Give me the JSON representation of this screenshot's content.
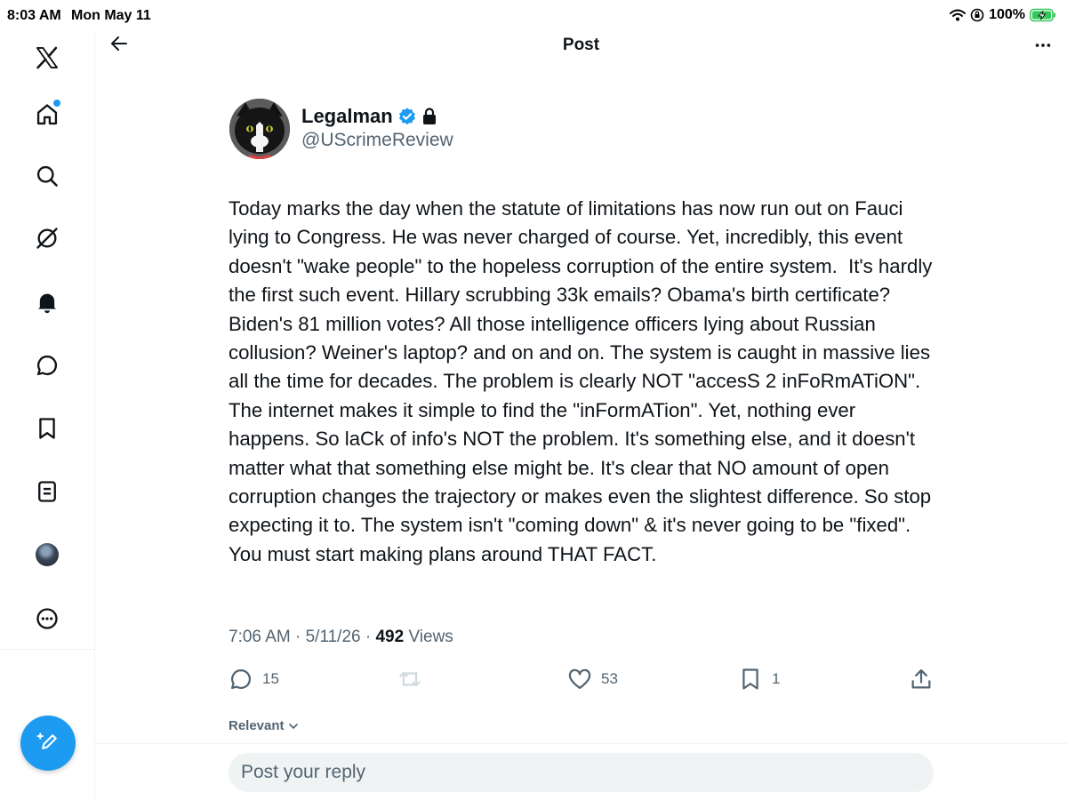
{
  "status_bar": {
    "time": "8:03 AM",
    "date": "Mon May 11",
    "battery": "100%",
    "icons": [
      "wifi-icon",
      "orientation-lock-icon",
      "battery-charging-icon"
    ]
  },
  "sidebar": {
    "items": [
      {
        "name": "x-logo",
        "icon": "x-logo-icon"
      },
      {
        "name": "home",
        "icon": "home-icon",
        "has_notification_dot": true
      },
      {
        "name": "explore",
        "icon": "search-icon"
      },
      {
        "name": "grok",
        "icon": "grok-icon"
      },
      {
        "name": "notifications",
        "icon": "bell-icon"
      },
      {
        "name": "messages",
        "icon": "message-icon"
      },
      {
        "name": "bookmarks",
        "icon": "bookmark-icon"
      },
      {
        "name": "lists",
        "icon": "list-icon"
      },
      {
        "name": "profile",
        "icon": "avatar"
      },
      {
        "name": "more",
        "icon": "more-circle-icon"
      }
    ],
    "compose_icon": "compose-icon"
  },
  "header": {
    "title": "Post",
    "back_icon": "arrow-left-icon",
    "more_icon": "more-dots-icon"
  },
  "post": {
    "author_name": "Legalman",
    "author_handle": "@UScrimeReview",
    "verified": true,
    "protected": true,
    "text": "Today marks the day when the statute of limitations has now run out on Fauci lying to Congress. He was never charged of course. Yet, incredibly, this event doesn't \"wake people\" to the hopeless corruption of the entire system.  It's hardly the first such event. Hillary scrubbing 33k emails? Obama's birth certificate? Biden's 81 million votes? All those intelligence officers lying about Russian collusion? Weiner's laptop? and on and on. The system is caught in massive lies all the time for decades. The problem is clearly NOT \"accesS 2 inFoRmATiON\". The internet makes it simple to find the \"inFormATion\". Yet, nothing ever happens. So laCk of info's NOT the problem. It's something else, and it doesn't matter what that something else might be. It's clear that NO amount of open corruption changes the trajectory or makes even the slightest difference. So stop expecting it to. The system isn't \"coming down\" & it's never going to be \"fixed\". You must start making plans around THAT FACT.",
    "time": "7:06 AM",
    "date": "5/11/26",
    "separator": "·",
    "views_count": "492",
    "views_label": "Views"
  },
  "actions": {
    "replies": "15",
    "reposts": "",
    "likes": "53",
    "bookmarks": "1"
  },
  "sort": {
    "label": "Relevant"
  },
  "reply": {
    "placeholder": "Post your reply"
  },
  "colors": {
    "accent": "#1d9bf0",
    "text": "#0f1419",
    "secondary": "#536471",
    "border": "#eff3f4",
    "battery": "#34c759"
  }
}
